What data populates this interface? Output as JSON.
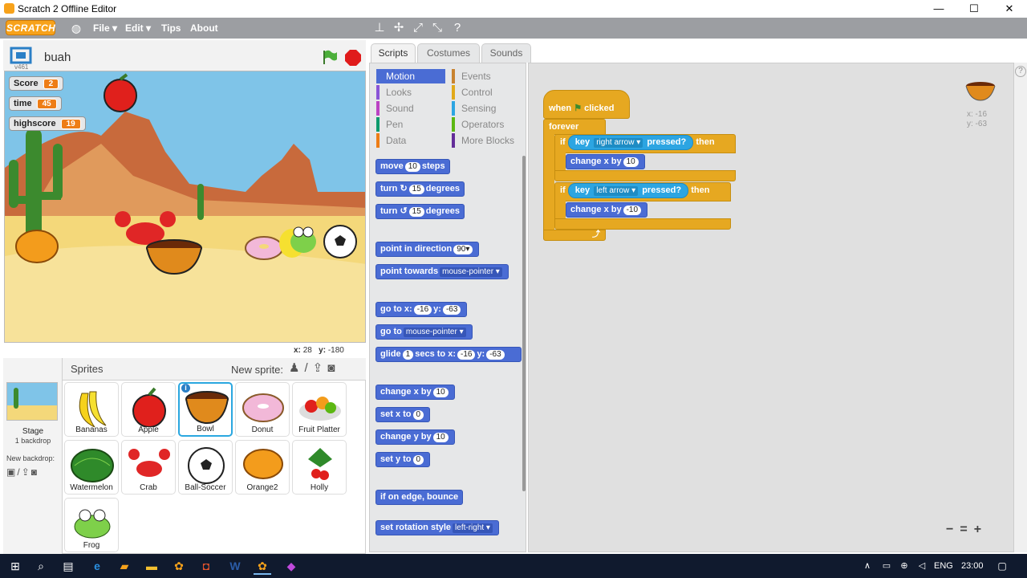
{
  "window": {
    "title": "Scratch 2 Offline Editor",
    "minimize": "—",
    "maximize": "☐",
    "close": "✕"
  },
  "menubar": {
    "logo": "SCRATCH",
    "menus": [
      "File ▾",
      "Edit ▾",
      "Tips",
      "About"
    ]
  },
  "stage": {
    "project_name": "buah",
    "version": "v461",
    "coord_x_label": "x:",
    "coord_x": "28",
    "coord_y_label": "y:",
    "coord_y": "-180"
  },
  "monitors": [
    {
      "label": "Score",
      "value": "2"
    },
    {
      "label": "time",
      "value": "45"
    },
    {
      "label": "highscore",
      "value": "19"
    }
  ],
  "sprites_panel": {
    "title": "Sprites",
    "new_sprite": "New sprite:",
    "stage_label": "Stage",
    "stage_backdrops": "1 backdrop",
    "new_backdrop": "New backdrop:",
    "sprites": [
      "Bananas",
      "Apple",
      "Bowl",
      "Donut",
      "Fruit Platter",
      "Watermelon",
      "Crab",
      "Ball-Soccer",
      "Orange2",
      "Holly",
      "Frog"
    ],
    "selected": "Bowl"
  },
  "tabs": [
    "Scripts",
    "Costumes",
    "Sounds"
  ],
  "categories": {
    "left": [
      "Motion",
      "Looks",
      "Sound",
      "Pen",
      "Data"
    ],
    "right": [
      "Events",
      "Control",
      "Sensing",
      "Operators",
      "More Blocks"
    ],
    "colors": {
      "Motion": "#4a6cd4",
      "Looks": "#8a55d7",
      "Sound": "#bb42c3",
      "Pen": "#0e9a6c",
      "Data": "#ee7d16",
      "Events": "#c88330",
      "Control": "#e1a91a",
      "Sensing": "#2ca5e2",
      "Operators": "#5cb712",
      "More Blocks": "#632d99"
    }
  },
  "blocks": {
    "move": [
      "move",
      "10",
      "steps"
    ],
    "turn_cw": [
      "turn",
      "↻",
      "15",
      "degrees"
    ],
    "turn_ccw": [
      "turn",
      "↺",
      "15",
      "degrees"
    ],
    "point_dir": [
      "point in direction",
      "90▾"
    ],
    "point_towards": [
      "point towards",
      "mouse-pointer ▾"
    ],
    "goto_xy": [
      "go to x:",
      "-16",
      "y:",
      "-63"
    ],
    "goto": [
      "go to",
      "mouse-pointer ▾"
    ],
    "glide": [
      "glide",
      "1",
      "secs to x:",
      "-16",
      "y:",
      "-63"
    ],
    "change_x": [
      "change x by",
      "10"
    ],
    "set_x": [
      "set x to",
      "0"
    ],
    "change_y": [
      "change y by",
      "10"
    ],
    "set_y": [
      "set y to",
      "0"
    ],
    "bounce": [
      "if on edge, bounce"
    ],
    "rotation": [
      "set rotation style",
      "left-right ▾"
    ]
  },
  "script": {
    "hat": [
      "when",
      "clicked"
    ],
    "forever": "forever",
    "if1": [
      "if",
      "key",
      "right arrow ▾",
      "pressed?",
      "then"
    ],
    "change1": [
      "change x by",
      "10"
    ],
    "if2": [
      "if",
      "key",
      "left arrow ▾",
      "pressed?",
      "then"
    ],
    "change2": [
      "change x by",
      "-10"
    ]
  },
  "sprite_info": {
    "x": "x: -16",
    "y": "y: -63"
  },
  "zoom": {
    "out": "−",
    "reset": "=",
    "in": "+"
  },
  "taskbar": {
    "lang": "ENG",
    "time": "23:00"
  }
}
